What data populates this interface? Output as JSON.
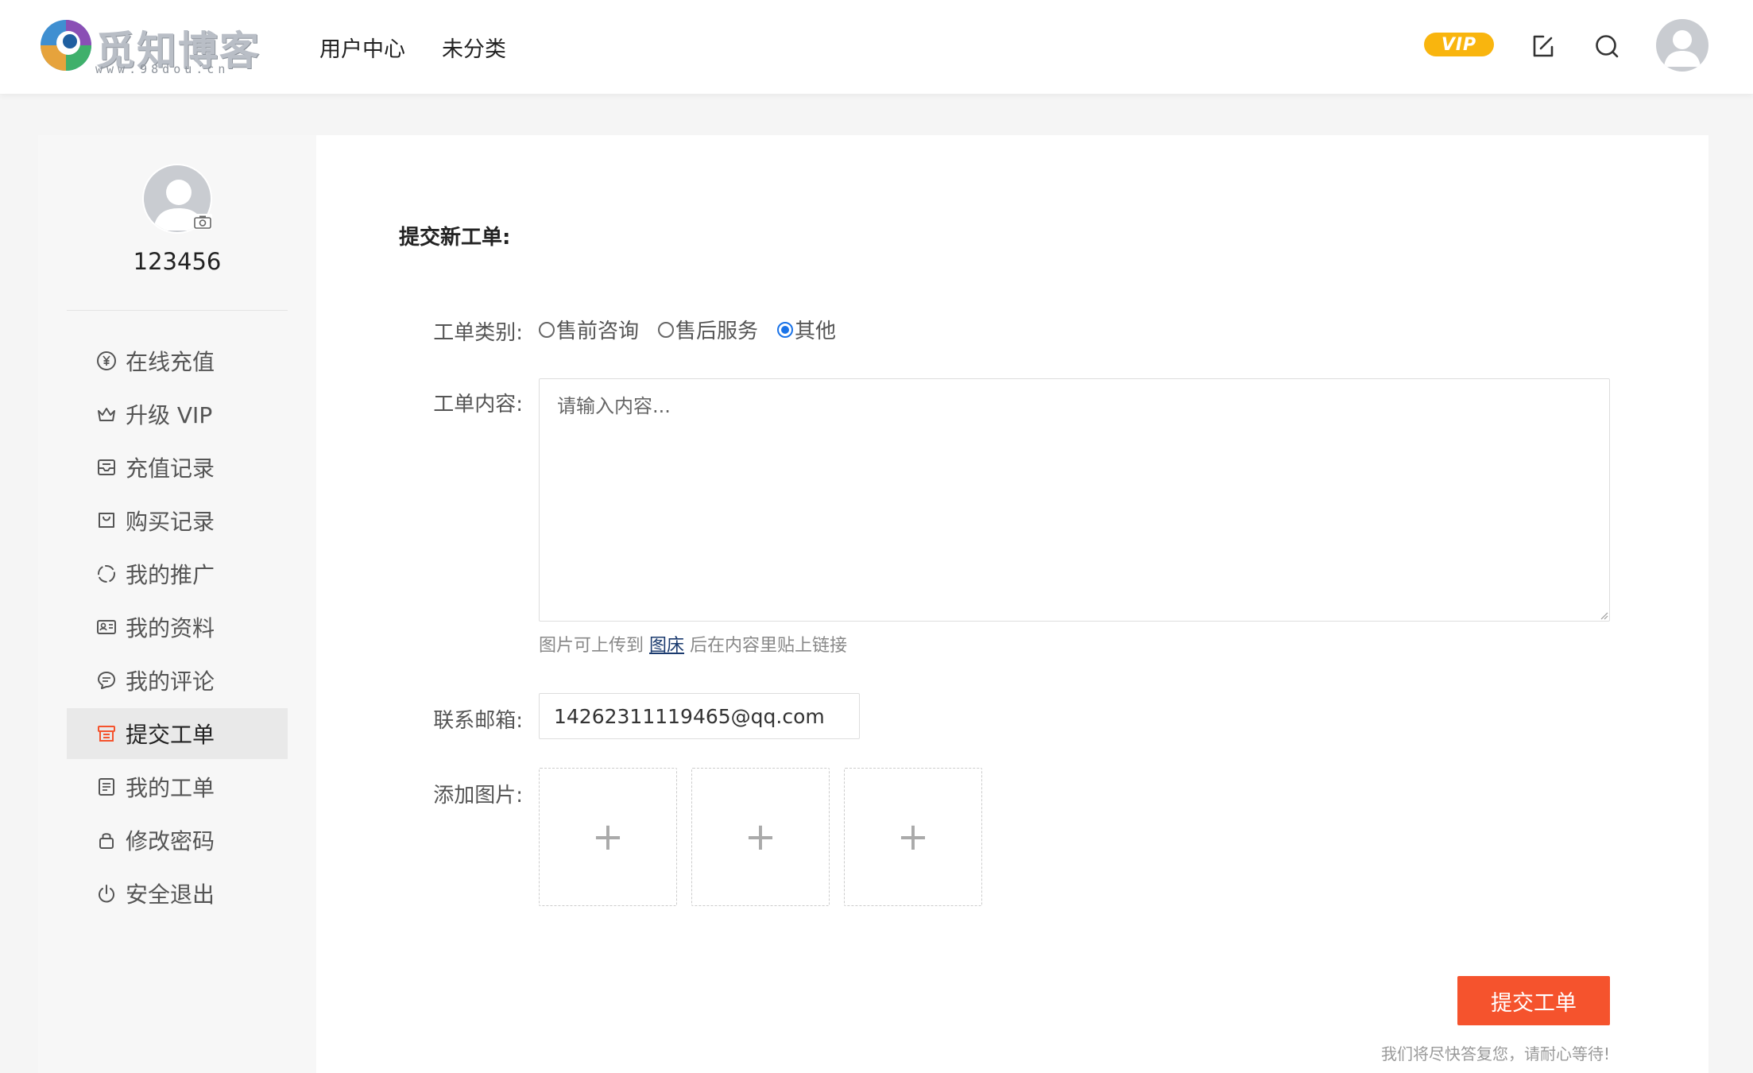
{
  "header": {
    "logo_title": "觅知博客",
    "logo_url": "www.98dou.cn",
    "nav": [
      "用户中心",
      "未分类"
    ],
    "vip_label": "VIP"
  },
  "sidebar": {
    "username": "123456",
    "items": [
      {
        "label": "在线充值",
        "icon": "yuan-circle-icon"
      },
      {
        "label": "升级 VIP",
        "icon": "crown-icon"
      },
      {
        "label": "充值记录",
        "icon": "inbox-icon"
      },
      {
        "label": "购买记录",
        "icon": "shopping-bag-icon"
      },
      {
        "label": "我的推广",
        "icon": "refresh-circle-icon"
      },
      {
        "label": "我的资料",
        "icon": "id-card-icon"
      },
      {
        "label": "我的评论",
        "icon": "chat-bubble-icon"
      },
      {
        "label": "提交工单",
        "icon": "ticket-icon",
        "active": true
      },
      {
        "label": "我的工单",
        "icon": "document-list-icon"
      },
      {
        "label": "修改密码",
        "icon": "lock-icon"
      },
      {
        "label": "安全退出",
        "icon": "power-icon"
      }
    ]
  },
  "form": {
    "title": "提交新工单:",
    "category_label": "工单类别:",
    "categories": [
      "售前咨询",
      "售后服务",
      "其他"
    ],
    "selected_category": "其他",
    "content_label": "工单内容:",
    "content_placeholder": "请输入内容...",
    "hint_before": "图片可上传到",
    "hint_link": "图床",
    "hint_after": "后在内容里贴上链接",
    "email_label": "联系邮箱:",
    "email_value": "14262311119465@qq.com",
    "image_label": "添加图片:",
    "upload_symbol": "+",
    "submit_label": "提交工单",
    "footer_note": "我们将尽快答复您，请耐心等待!"
  },
  "colors": {
    "accent": "#f5532d",
    "vip": "#f9b50e",
    "radio_checked": "#1a73e8"
  }
}
